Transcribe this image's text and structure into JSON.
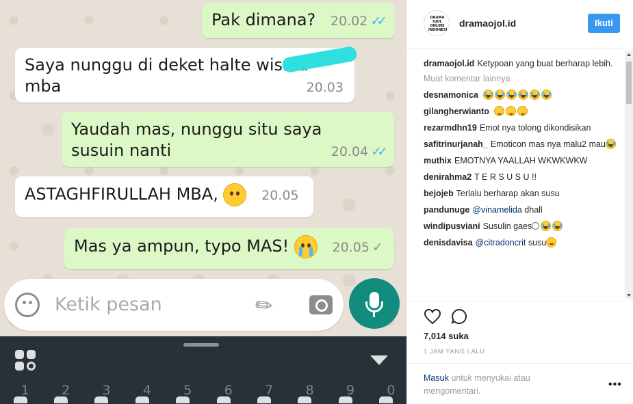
{
  "chat": {
    "messages": [
      {
        "text": "Pak dimana?",
        "time": "20.02",
        "dir": "out",
        "ticks": "blue"
      },
      {
        "text": "Saya nunggu di deket halte wisma",
        "text2": "mba",
        "time": "20.03",
        "dir": "in"
      },
      {
        "text": "Yaudah mas, nunggu situ saya",
        "text2": "susuin nanti",
        "time": "20.04",
        "dir": "out",
        "ticks": "blue"
      },
      {
        "text": "ASTAGHFIRULLAH MBA,",
        "time": "20.05",
        "dir": "in",
        "emoji": "hugging-face"
      },
      {
        "text": "Mas ya ampun, typo MAS!",
        "time": "20.05",
        "dir": "out",
        "ticks": "grey",
        "emoji": "crying-face"
      }
    ],
    "input_placeholder": "Ketik pesan",
    "keyboard_numbers": [
      "1",
      "2",
      "3",
      "4",
      "5",
      "6",
      "7",
      "8",
      "9",
      "0"
    ],
    "colors": {
      "outgoing": "#dcf8c6",
      "incoming": "#ffffff",
      "mic": "#128c7e",
      "keyboard": "#263238"
    }
  },
  "instagram": {
    "username": "dramaojol.id",
    "avatar_text": "DRAMA OJOL ONLINE INDONESIA",
    "follow_label": "Ikuti",
    "caption_user": "dramaojol.id",
    "caption_text": "Ketypoan yang buat berharap lebih.",
    "load_more": "Muat komentar lainnya",
    "comments": [
      {
        "user": "desnamonica",
        "text": ""
      },
      {
        "user": "gilangherwianto",
        "text": ""
      },
      {
        "user": "rezarmdhn19",
        "text": "Emot nya tolong dikondisikan"
      },
      {
        "user": "safitrinurjanah_",
        "text": "Emoticon mas nya malu2 mau"
      },
      {
        "user": "muthix",
        "text": "EMOTNYA YAALLAH WKWKWKW"
      },
      {
        "user": "denirahma2",
        "text": "T E R S U S U !!"
      },
      {
        "user": "bejojeb",
        "text": "Terlalu berharap akan susu"
      },
      {
        "user": "pandunuge",
        "mention": "@vinamelida",
        "text": "dhall"
      },
      {
        "user": "windipusviani",
        "text": "Susulin gaes"
      },
      {
        "user": "denisdavisa",
        "mention": "@citradoncrit",
        "text": "susu"
      }
    ],
    "likes": "7,014 suka",
    "time_ago": "1 JAM YANG LALU",
    "login_link": "Masuk",
    "login_rest": "untuk menyukai atau mengomentari.",
    "more_options": "•••",
    "colors": {
      "follow": "#3897f0",
      "link": "#003569"
    }
  }
}
